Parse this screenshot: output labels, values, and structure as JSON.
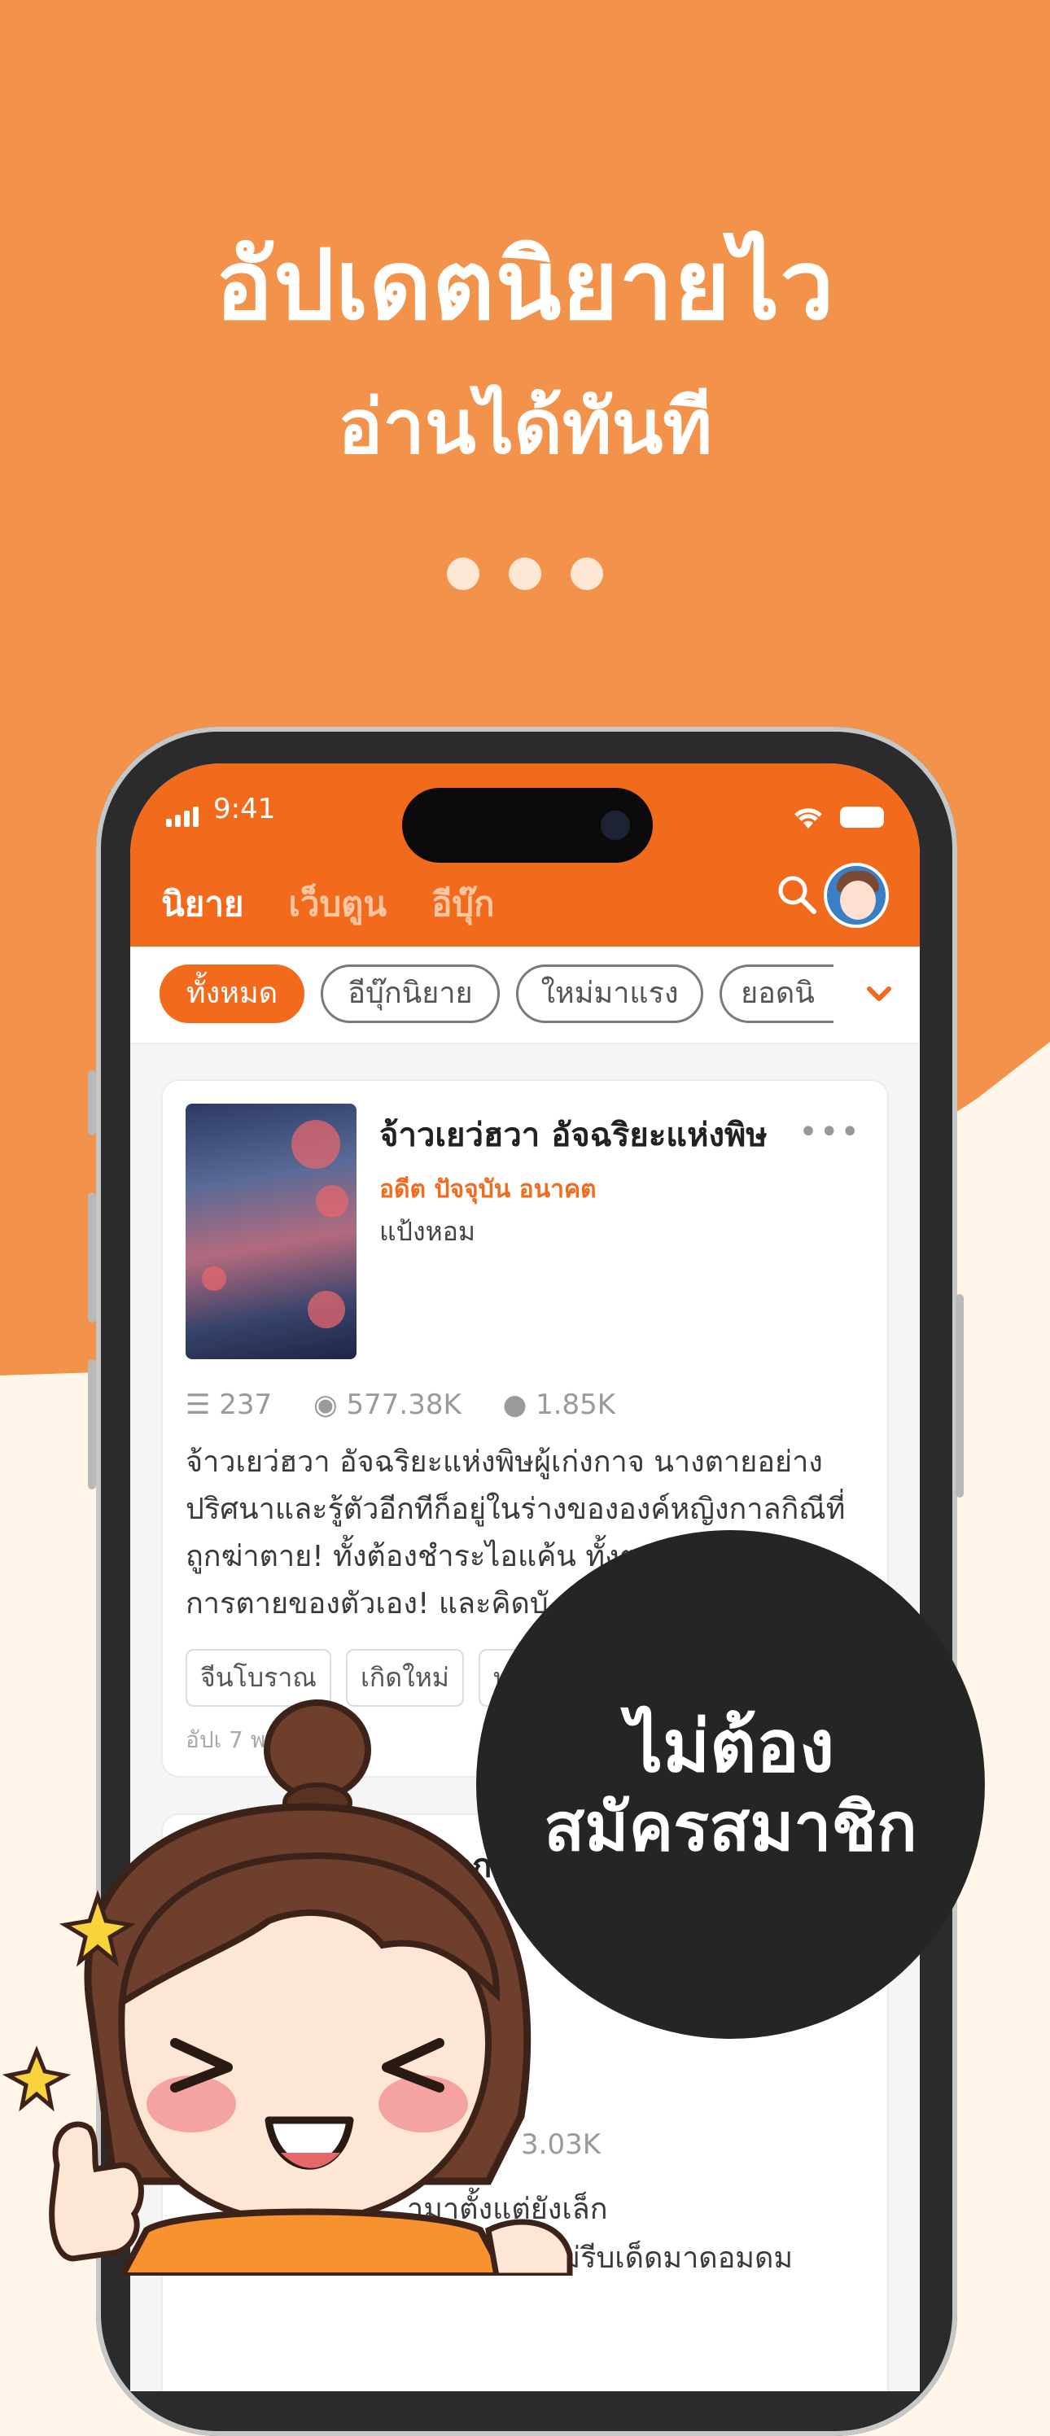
{
  "promo": {
    "headline": "อัปเดตนิยายไว",
    "subheadline": "อ่านได้ทันที",
    "badge_line1": "ไม่ต้อง",
    "badge_line2": "สมัครสมาชิก",
    "colors": {
      "background": "#f3924a",
      "accent": "#f26b1d",
      "badge": "#252525"
    }
  },
  "status_bar": {
    "time": "9:41"
  },
  "app": {
    "tabs": [
      {
        "label": "นิยาย",
        "active": true
      },
      {
        "label": "เว็บตูน",
        "active": false
      },
      {
        "label": "อีบุ๊ก",
        "active": false
      }
    ],
    "icons": {
      "search": "search-icon",
      "avatar": "user-avatar",
      "expand": "chevron-down-icon"
    },
    "filters": [
      {
        "label": "ทั้งหมด",
        "active": true
      },
      {
        "label": "อีบุ๊กนิยาย",
        "active": false
      },
      {
        "label": "ใหม่มาแรง",
        "active": false
      },
      {
        "label": "ยอดนิ",
        "active": false
      }
    ]
  },
  "cards": [
    {
      "title": "จ้าวเยว่ฮวา อัจฉริยะแห่งพิษ",
      "genre": "อดีต ปัจจุบัน อนาคต",
      "author": "แป้งหอม",
      "chapters": "237",
      "views": "577.38K",
      "comments": "1.85K",
      "description": [
        "จ้าวเยว่ฮวา อัจฉริยะแห่งพิษผู้เก่งกาจ นางตายอย่าง",
        "ปริศนาและรู้ตัวอีกทีก็อยู่ในร่างขององค์หญิงกาลกิณีที่",
        "ถูกฆ่าตาย! ทั้งต้องชำระไอแค้น ทั้งต",
        "การตายของตัวเอง! และคิดบั"
      ],
      "tags": [
        "จีนโบราณ",
        "เกิดใหม่",
        "ท"
      ],
      "updated": "อัปเ    7 พ.ค. 67 / 0"
    },
    {
      "title": "ดอก",
      "comments": "3.03K",
      "description": [
        "ามาตั้งแต่ยังเล็ก",
        "ล้า เขาจะไม่รีบเด็ดมาดอมดม"
      ]
    }
  ]
}
